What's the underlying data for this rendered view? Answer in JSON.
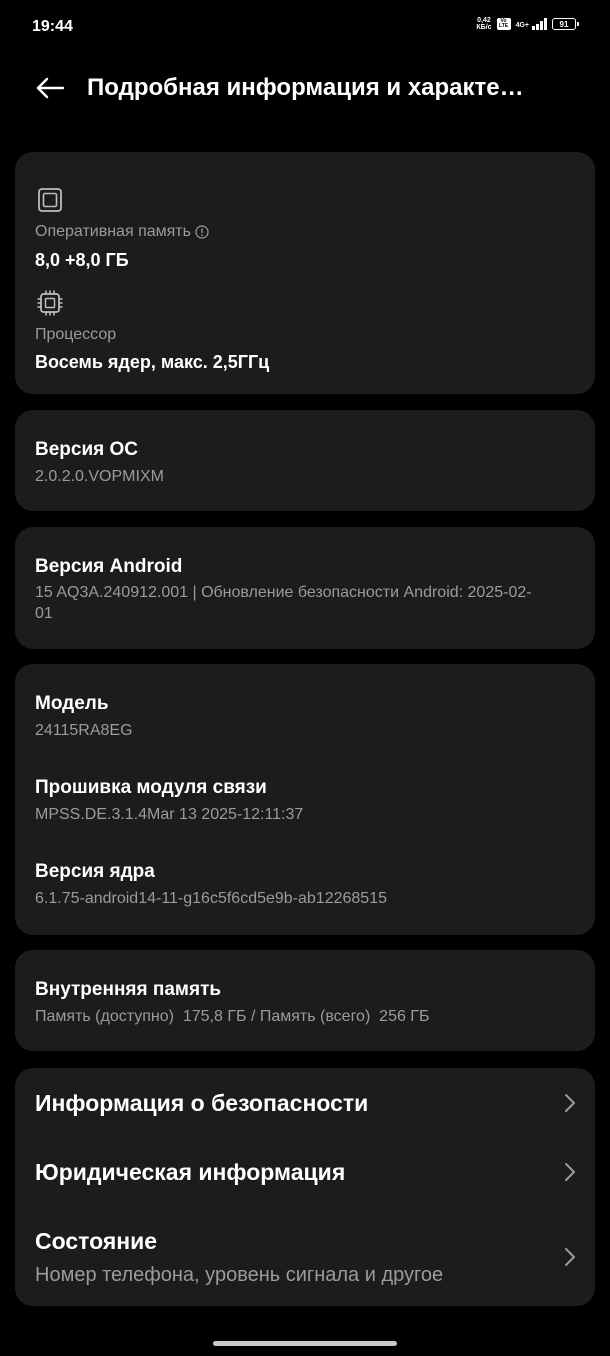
{
  "status_bar": {
    "time": "19:44",
    "net_speed_value": "0,42",
    "net_speed_unit": "КБ/с",
    "volte_line1": "Vo",
    "volte_line2": "LTE",
    "network_type": "4G+",
    "battery": "91"
  },
  "app_bar": {
    "title": "Подробная информация и характер…"
  },
  "hardware": {
    "ram_label": "Оперативная память",
    "ram_value": "8,0 +8,0 ГБ",
    "cpu_label": "Процессор",
    "cpu_value": "Восемь ядер, макс. 2,5ГГц"
  },
  "os_version": {
    "title": "Версия ОС",
    "value": "2.0.2.0.VOPMIXM"
  },
  "android_version": {
    "title": "Версия Android",
    "value": "15 AQ3A.240912.001 | Обновление безопасности Android: 2025-02-01"
  },
  "device": {
    "model_title": "Модель",
    "model_value": "24115RA8EG",
    "baseband_title": "Прошивка модуля связи",
    "baseband_value": "MPSS.DE.3.1.4Mar 13 2025-12:11:37",
    "kernel_title": "Версия ядра",
    "kernel_value": "6.1.75-android14-11-g16c5f6cd5e9b-ab12268515"
  },
  "storage": {
    "title": "Внутренняя память",
    "value": "Память (доступно)  175,8 ГБ / Память (всего)  256 ГБ"
  },
  "links": [
    {
      "title": "Информация о безопасности",
      "subtitle": ""
    },
    {
      "title": "Юридическая информация",
      "subtitle": ""
    },
    {
      "title": "Состояние",
      "subtitle": "Номер телефона, уровень сигнала и другое"
    }
  ],
  "icons": {
    "back": "arrow-left-icon",
    "ram": "memory-chip-icon",
    "cpu": "processor-chip-icon",
    "info": "info-circle-icon",
    "chevron": "chevron-right-icon"
  }
}
